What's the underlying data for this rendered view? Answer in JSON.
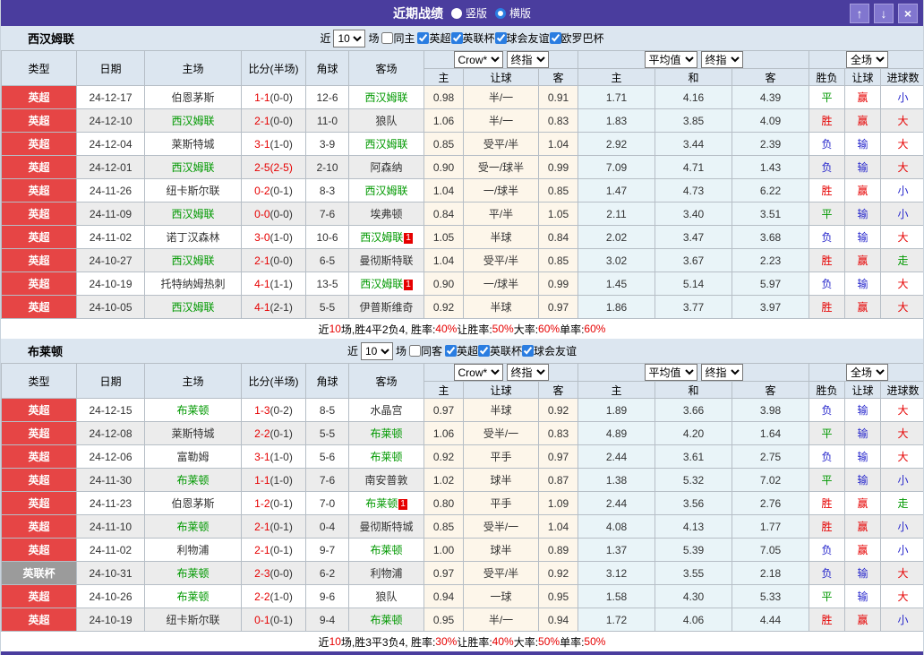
{
  "titlebar": {
    "title": "近期战绩",
    "radios": [
      {
        "label": "竖版",
        "selected": false
      },
      {
        "label": "横版",
        "selected": true
      }
    ],
    "buttons": {
      "up": "↑",
      "down": "↓",
      "close": "×"
    }
  },
  "colors": {
    "accent_purple": "#4a3d9e",
    "badge_red": "#e64545",
    "badge_gray": "#9b9b9b",
    "text_red": "#e60000",
    "text_green": "#009900",
    "text_blue": "#2727cc",
    "crow_odds_bg": "#fdf6ea",
    "avg_odds_bg": "#e9f4f8"
  },
  "table_header": {
    "league": "类型",
    "date": "日期",
    "home": "主场",
    "score": "比分(半场)",
    "corner": "角球",
    "away": "客场",
    "selects": {
      "crow": "Crow*",
      "final1": "终指",
      "avg": "平均值",
      "final2": "终指",
      "full": "全场"
    },
    "sub": [
      "主",
      "让球",
      "客",
      "主",
      "和",
      "客",
      "胜负",
      "让球",
      "进球数"
    ]
  },
  "sections": [
    {
      "team": "西汉姆联",
      "filter": {
        "near": "近",
        "count": "10",
        "games": "场",
        "same": {
          "label": "同主",
          "checked": false
        },
        "leagues": [
          {
            "label": "英超",
            "checked": true
          },
          {
            "label": "英联杯",
            "checked": true
          },
          {
            "label": "球会友谊",
            "checked": true
          },
          {
            "label": "欧罗巴杯",
            "checked": true
          }
        ]
      },
      "rows": [
        {
          "league": "英超",
          "league_style": "red",
          "date": "24-12-17",
          "home": "伯恩茅斯",
          "home_focus": false,
          "home_card": "",
          "score": "1-1",
          "half": "(0-0)",
          "half_red": false,
          "corner": "12-6",
          "away": "西汉姆联",
          "away_focus": true,
          "away_card": "",
          "crow": [
            "0.98",
            "半/一",
            "0.91"
          ],
          "avg": [
            "1.71",
            "4.16",
            "4.39"
          ],
          "results": [
            {
              "t": "平",
              "c": "green"
            },
            {
              "t": "赢",
              "c": "red"
            },
            {
              "t": "小",
              "c": "blue"
            }
          ]
        },
        {
          "league": "英超",
          "league_style": "red",
          "date": "24-12-10",
          "home": "西汉姆联",
          "home_focus": true,
          "home_card": "",
          "score": "2-1",
          "half": "(0-0)",
          "half_red": false,
          "corner": "11-0",
          "away": "狼队",
          "away_focus": false,
          "away_card": "",
          "crow": [
            "1.06",
            "半/一",
            "0.83"
          ],
          "avg": [
            "1.83",
            "3.85",
            "4.09"
          ],
          "results": [
            {
              "t": "胜",
              "c": "red"
            },
            {
              "t": "赢",
              "c": "red"
            },
            {
              "t": "大",
              "c": "red"
            }
          ]
        },
        {
          "league": "英超",
          "league_style": "red",
          "date": "24-12-04",
          "home": "莱斯特城",
          "home_focus": false,
          "home_card": "",
          "score": "3-1",
          "half": "(1-0)",
          "half_red": false,
          "corner": "3-9",
          "away": "西汉姆联",
          "away_focus": true,
          "away_card": "",
          "crow": [
            "0.85",
            "受平/半",
            "1.04"
          ],
          "avg": [
            "2.92",
            "3.44",
            "2.39"
          ],
          "results": [
            {
              "t": "负",
              "c": "blue"
            },
            {
              "t": "输",
              "c": "blue"
            },
            {
              "t": "大",
              "c": "red"
            }
          ]
        },
        {
          "league": "英超",
          "league_style": "red",
          "date": "24-12-01",
          "home": "西汉姆联",
          "home_focus": true,
          "home_card": "",
          "score": "2-5",
          "half": "(2-5)",
          "half_red": true,
          "corner": "2-10",
          "away": "阿森纳",
          "away_focus": false,
          "away_card": "",
          "crow": [
            "0.90",
            "受一/球半",
            "0.99"
          ],
          "avg": [
            "7.09",
            "4.71",
            "1.43"
          ],
          "results": [
            {
              "t": "负",
              "c": "blue"
            },
            {
              "t": "输",
              "c": "blue"
            },
            {
              "t": "大",
              "c": "red"
            }
          ]
        },
        {
          "league": "英超",
          "league_style": "red",
          "date": "24-11-26",
          "home": "纽卡斯尔联",
          "home_focus": false,
          "home_card": "",
          "score": "0-2",
          "half": "(0-1)",
          "half_red": false,
          "corner": "8-3",
          "away": "西汉姆联",
          "away_focus": true,
          "away_card": "",
          "crow": [
            "1.04",
            "一/球半",
            "0.85"
          ],
          "avg": [
            "1.47",
            "4.73",
            "6.22"
          ],
          "results": [
            {
              "t": "胜",
              "c": "red"
            },
            {
              "t": "赢",
              "c": "red"
            },
            {
              "t": "小",
              "c": "blue"
            }
          ]
        },
        {
          "league": "英超",
          "league_style": "red",
          "date": "24-11-09",
          "home": "西汉姆联",
          "home_focus": true,
          "home_card": "",
          "score": "0-0",
          "half": "(0-0)",
          "half_red": false,
          "corner": "7-6",
          "away": "埃弗顿",
          "away_focus": false,
          "away_card": "",
          "crow": [
            "0.84",
            "平/半",
            "1.05"
          ],
          "avg": [
            "2.11",
            "3.40",
            "3.51"
          ],
          "results": [
            {
              "t": "平",
              "c": "green"
            },
            {
              "t": "输",
              "c": "blue"
            },
            {
              "t": "小",
              "c": "blue"
            }
          ]
        },
        {
          "league": "英超",
          "league_style": "red",
          "date": "24-11-02",
          "home": "诺丁汉森林",
          "home_focus": false,
          "home_card": "",
          "score": "3-0",
          "half": "(1-0)",
          "half_red": false,
          "corner": "10-6",
          "away": "西汉姆联",
          "away_focus": true,
          "away_card": "1",
          "crow": [
            "1.05",
            "半球",
            "0.84"
          ],
          "avg": [
            "2.02",
            "3.47",
            "3.68"
          ],
          "results": [
            {
              "t": "负",
              "c": "blue"
            },
            {
              "t": "输",
              "c": "blue"
            },
            {
              "t": "大",
              "c": "red"
            }
          ]
        },
        {
          "league": "英超",
          "league_style": "red",
          "date": "24-10-27",
          "home": "西汉姆联",
          "home_focus": true,
          "home_card": "",
          "score": "2-1",
          "half": "(0-0)",
          "half_red": false,
          "corner": "6-5",
          "away": "曼彻斯特联",
          "away_focus": false,
          "away_card": "",
          "crow": [
            "1.04",
            "受平/半",
            "0.85"
          ],
          "avg": [
            "3.02",
            "3.67",
            "2.23"
          ],
          "results": [
            {
              "t": "胜",
              "c": "red"
            },
            {
              "t": "赢",
              "c": "red"
            },
            {
              "t": "走",
              "c": "green"
            }
          ]
        },
        {
          "league": "英超",
          "league_style": "red",
          "date": "24-10-19",
          "home": "托特纳姆热刺",
          "home_focus": false,
          "home_card": "",
          "score": "4-1",
          "half": "(1-1)",
          "half_red": false,
          "corner": "13-5",
          "away": "西汉姆联",
          "away_focus": true,
          "away_card": "1",
          "crow": [
            "0.90",
            "一/球半",
            "0.99"
          ],
          "avg": [
            "1.45",
            "5.14",
            "5.97"
          ],
          "results": [
            {
              "t": "负",
              "c": "blue"
            },
            {
              "t": "输",
              "c": "blue"
            },
            {
              "t": "大",
              "c": "red"
            }
          ]
        },
        {
          "league": "英超",
          "league_style": "red",
          "date": "24-10-05",
          "home": "西汉姆联",
          "home_focus": true,
          "home_card": "",
          "score": "4-1",
          "half": "(2-1)",
          "half_red": false,
          "corner": "5-5",
          "away": "伊普斯维奇",
          "away_focus": false,
          "away_card": "",
          "crow": [
            "0.92",
            "半球",
            "0.97"
          ],
          "avg": [
            "1.86",
            "3.77",
            "3.97"
          ],
          "results": [
            {
              "t": "胜",
              "c": "red"
            },
            {
              "t": "赢",
              "c": "red"
            },
            {
              "t": "大",
              "c": "red"
            }
          ]
        }
      ],
      "summary": [
        {
          "t": "近"
        },
        {
          "t": "10",
          "r": true
        },
        {
          "t": "场,胜4平2负4, 胜率:"
        },
        {
          "t": "40%",
          "r": true
        },
        {
          "t": " 让胜率:"
        },
        {
          "t": "50%",
          "r": true
        },
        {
          "t": " 大率:"
        },
        {
          "t": "60%",
          "r": true
        },
        {
          "t": " 单率:"
        },
        {
          "t": "60%",
          "r": true
        }
      ]
    },
    {
      "team": "布莱顿",
      "filter": {
        "near": "近",
        "count": "10",
        "games": "场",
        "same": {
          "label": "同客",
          "checked": false
        },
        "leagues": [
          {
            "label": "英超",
            "checked": true
          },
          {
            "label": "英联杯",
            "checked": true
          },
          {
            "label": "球会友谊",
            "checked": true
          }
        ]
      },
      "rows": [
        {
          "league": "英超",
          "league_style": "red",
          "date": "24-12-15",
          "home": "布莱顿",
          "home_focus": true,
          "home_card": "",
          "score": "1-3",
          "half": "(0-2)",
          "half_red": false,
          "corner": "8-5",
          "away": "水晶宫",
          "away_focus": false,
          "away_card": "",
          "crow": [
            "0.97",
            "半球",
            "0.92"
          ],
          "avg": [
            "1.89",
            "3.66",
            "3.98"
          ],
          "results": [
            {
              "t": "负",
              "c": "blue"
            },
            {
              "t": "输",
              "c": "blue"
            },
            {
              "t": "大",
              "c": "red"
            }
          ]
        },
        {
          "league": "英超",
          "league_style": "red",
          "date": "24-12-08",
          "home": "莱斯特城",
          "home_focus": false,
          "home_card": "",
          "score": "2-2",
          "half": "(0-1)",
          "half_red": false,
          "corner": "5-5",
          "away": "布莱顿",
          "away_focus": true,
          "away_card": "",
          "crow": [
            "1.06",
            "受半/一",
            "0.83"
          ],
          "avg": [
            "4.89",
            "4.20",
            "1.64"
          ],
          "results": [
            {
              "t": "平",
              "c": "green"
            },
            {
              "t": "输",
              "c": "blue"
            },
            {
              "t": "大",
              "c": "red"
            }
          ]
        },
        {
          "league": "英超",
          "league_style": "red",
          "date": "24-12-06",
          "home": "富勒姆",
          "home_focus": false,
          "home_card": "",
          "score": "3-1",
          "half": "(1-0)",
          "half_red": false,
          "corner": "5-6",
          "away": "布莱顿",
          "away_focus": true,
          "away_card": "",
          "crow": [
            "0.92",
            "平手",
            "0.97"
          ],
          "avg": [
            "2.44",
            "3.61",
            "2.75"
          ],
          "results": [
            {
              "t": "负",
              "c": "blue"
            },
            {
              "t": "输",
              "c": "blue"
            },
            {
              "t": "大",
              "c": "red"
            }
          ]
        },
        {
          "league": "英超",
          "league_style": "red",
          "date": "24-11-30",
          "home": "布莱顿",
          "home_focus": true,
          "home_card": "",
          "score": "1-1",
          "half": "(1-0)",
          "half_red": false,
          "corner": "7-6",
          "away": "南安普敦",
          "away_focus": false,
          "away_card": "",
          "crow": [
            "1.02",
            "球半",
            "0.87"
          ],
          "avg": [
            "1.38",
            "5.32",
            "7.02"
          ],
          "results": [
            {
              "t": "平",
              "c": "green"
            },
            {
              "t": "输",
              "c": "blue"
            },
            {
              "t": "小",
              "c": "blue"
            }
          ]
        },
        {
          "league": "英超",
          "league_style": "red",
          "date": "24-11-23",
          "home": "伯恩茅斯",
          "home_focus": false,
          "home_card": "",
          "score": "1-2",
          "half": "(0-1)",
          "half_red": false,
          "corner": "7-0",
          "away": "布莱顿",
          "away_focus": true,
          "away_card": "1",
          "crow": [
            "0.80",
            "平手",
            "1.09"
          ],
          "avg": [
            "2.44",
            "3.56",
            "2.76"
          ],
          "results": [
            {
              "t": "胜",
              "c": "red"
            },
            {
              "t": "赢",
              "c": "red"
            },
            {
              "t": "走",
              "c": "green"
            }
          ]
        },
        {
          "league": "英超",
          "league_style": "red",
          "date": "24-11-10",
          "home": "布莱顿",
          "home_focus": true,
          "home_card": "",
          "score": "2-1",
          "half": "(0-1)",
          "half_red": false,
          "corner": "0-4",
          "away": "曼彻斯特城",
          "away_focus": false,
          "away_card": "",
          "crow": [
            "0.85",
            "受半/一",
            "1.04"
          ],
          "avg": [
            "4.08",
            "4.13",
            "1.77"
          ],
          "results": [
            {
              "t": "胜",
              "c": "red"
            },
            {
              "t": "赢",
              "c": "red"
            },
            {
              "t": "小",
              "c": "blue"
            }
          ]
        },
        {
          "league": "英超",
          "league_style": "red",
          "date": "24-11-02",
          "home": "利物浦",
          "home_focus": false,
          "home_card": "",
          "score": "2-1",
          "half": "(0-1)",
          "half_red": false,
          "corner": "9-7",
          "away": "布莱顿",
          "away_focus": true,
          "away_card": "",
          "crow": [
            "1.00",
            "球半",
            "0.89"
          ],
          "avg": [
            "1.37",
            "5.39",
            "7.05"
          ],
          "results": [
            {
              "t": "负",
              "c": "blue"
            },
            {
              "t": "赢",
              "c": "red"
            },
            {
              "t": "小",
              "c": "blue"
            }
          ]
        },
        {
          "league": "英联杯",
          "league_style": "gray",
          "date": "24-10-31",
          "home": "布莱顿",
          "home_focus": true,
          "home_card": "",
          "score": "2-3",
          "half": "(0-0)",
          "half_red": false,
          "corner": "6-2",
          "away": "利物浦",
          "away_focus": false,
          "away_card": "",
          "crow": [
            "0.97",
            "受平/半",
            "0.92"
          ],
          "avg": [
            "3.12",
            "3.55",
            "2.18"
          ],
          "results": [
            {
              "t": "负",
              "c": "blue"
            },
            {
              "t": "输",
              "c": "blue"
            },
            {
              "t": "大",
              "c": "red"
            }
          ]
        },
        {
          "league": "英超",
          "league_style": "red",
          "date": "24-10-26",
          "home": "布莱顿",
          "home_focus": true,
          "home_card": "",
          "score": "2-2",
          "half": "(1-0)",
          "half_red": false,
          "corner": "9-6",
          "away": "狼队",
          "away_focus": false,
          "away_card": "",
          "crow": [
            "0.94",
            "一球",
            "0.95"
          ],
          "avg": [
            "1.58",
            "4.30",
            "5.33"
          ],
          "results": [
            {
              "t": "平",
              "c": "green"
            },
            {
              "t": "输",
              "c": "blue"
            },
            {
              "t": "大",
              "c": "red"
            }
          ]
        },
        {
          "league": "英超",
          "league_style": "red",
          "date": "24-10-19",
          "home": "纽卡斯尔联",
          "home_focus": false,
          "home_card": "",
          "score": "0-1",
          "half": "(0-1)",
          "half_red": false,
          "corner": "9-4",
          "away": "布莱顿",
          "away_focus": true,
          "away_card": "",
          "crow": [
            "0.95",
            "半/一",
            "0.94"
          ],
          "avg": [
            "1.72",
            "4.06",
            "4.44"
          ],
          "results": [
            {
              "t": "胜",
              "c": "red"
            },
            {
              "t": "赢",
              "c": "red"
            },
            {
              "t": "小",
              "c": "blue"
            }
          ]
        }
      ],
      "summary": [
        {
          "t": "近"
        },
        {
          "t": "10",
          "r": true
        },
        {
          "t": "场,胜3平3负4, 胜率:"
        },
        {
          "t": "30%",
          "r": true
        },
        {
          "t": " 让胜率:"
        },
        {
          "t": "40%",
          "r": true
        },
        {
          "t": " 大率:"
        },
        {
          "t": "50%",
          "r": true
        },
        {
          "t": " 单率:"
        },
        {
          "t": "50%",
          "r": true
        }
      ]
    }
  ]
}
